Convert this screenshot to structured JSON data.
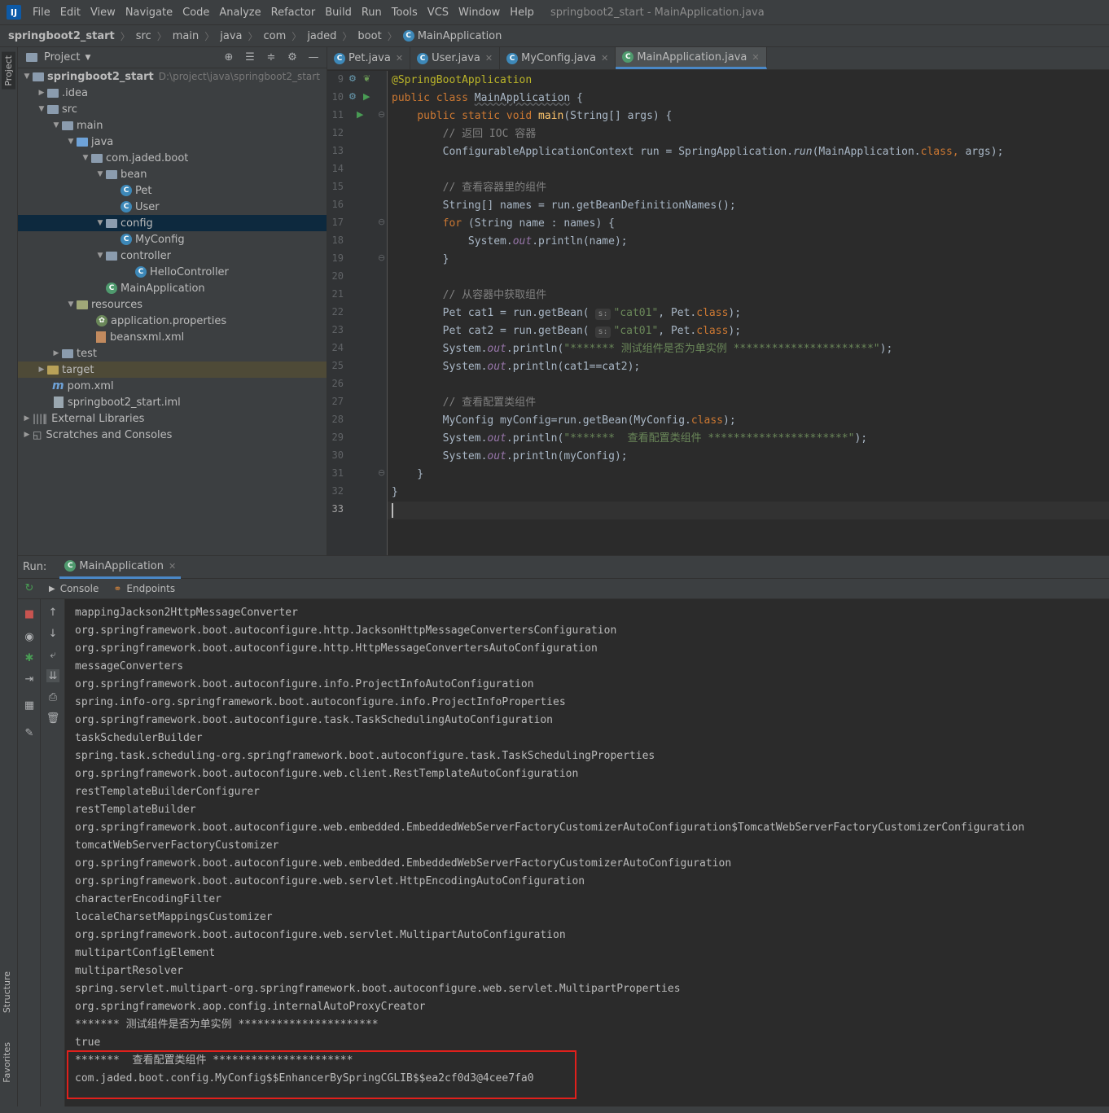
{
  "app": {
    "logo": "IJ",
    "window_title": "springboot2_start - MainApplication.java"
  },
  "menu": [
    "File",
    "Edit",
    "View",
    "Navigate",
    "Code",
    "Analyze",
    "Refactor",
    "Build",
    "Run",
    "Tools",
    "VCS",
    "Window",
    "Help"
  ],
  "breadcrumb": [
    "springboot2_start",
    "src",
    "main",
    "java",
    "com",
    "jaded",
    "boot",
    "MainApplication"
  ],
  "left_strip": {
    "project": "Project",
    "structure": "Structure",
    "favorites": "Favorites"
  },
  "project": {
    "title": "Project",
    "tree": [
      {
        "label": "springboot2_start",
        "path": "D:\\project\\java\\springboot2_start"
      },
      {
        "label": ".idea"
      },
      {
        "label": "src"
      },
      {
        "label": "main"
      },
      {
        "label": "java"
      },
      {
        "label": "com.jaded.boot"
      },
      {
        "label": "bean"
      },
      {
        "label": "Pet"
      },
      {
        "label": "User"
      },
      {
        "label": "config"
      },
      {
        "label": "MyConfig"
      },
      {
        "label": "controller"
      },
      {
        "label": "HelloController"
      },
      {
        "label": "MainApplication"
      },
      {
        "label": "resources"
      },
      {
        "label": "application.properties"
      },
      {
        "label": "beansxml.xml"
      },
      {
        "label": "test"
      },
      {
        "label": "target"
      },
      {
        "label": "pom.xml"
      },
      {
        "label": "springboot2_start.iml"
      },
      {
        "label": "External Libraries"
      },
      {
        "label": "Scratches and Consoles"
      }
    ]
  },
  "tabs": [
    {
      "label": "Pet.java"
    },
    {
      "label": "User.java"
    },
    {
      "label": "MyConfig.java"
    },
    {
      "label": "MainApplication.java"
    }
  ],
  "line_numbers": [
    "9",
    "10",
    "11",
    "12",
    "13",
    "14",
    "15",
    "16",
    "17",
    "18",
    "19",
    "20",
    "21",
    "22",
    "23",
    "24",
    "25",
    "26",
    "27",
    "28",
    "29",
    "30",
    "31",
    "32",
    "33"
  ],
  "code": {
    "l9a": "@SpringBootApplication",
    "l10a": "public class ",
    "l10b": "MainApplication",
    " l10c": " {",
    "l11a": "    public static void ",
    "l11b": "main",
    "l11c": "(String[] args) {",
    "l12": "        // 返回 IOC 容器",
    "l13a": "        ConfigurableApplicationContext run = SpringApplication.",
    "l13b": "run",
    "l13c": "(MainApplication.",
    "l13d": "class",
    ", l13e": ", args);",
    "l15": "        // 查看容器里的组件",
    "l16": "        String[] names = run.getBeanDefinitionNames();",
    "l17a": "        for ",
    "l17b": "(String name : names) {",
    "l18a": "            System.",
    "l18b": "out",
    "l18c": ".println(name);",
    "l19": "        }",
    "l21": "        // 从容器中获取组件",
    "l22a": "        Pet cat1 = run.getBean( ",
    "l22h": "s:",
    "l22b": "\"cat01\"",
    "l22c": ", Pet.",
    "l22d": "class",
    "l22e": ");",
    "l23a": "        Pet cat2 = run.getBean( ",
    "l23h": "s:",
    "l23b": "\"cat01\"",
    "l23c": ", Pet.",
    "l23d": "class",
    "l23e": ");",
    "l24a": "        System.",
    "l24b": "out",
    "l24c": ".println(",
    "l24d": "\"******* 测试组件是否为单实例 **********************\"",
    "l24e": ");",
    "l25a": "        System.",
    "l25b": "out",
    "l25c": ".println(cat1==cat2);",
    "l27": "        // 查看配置类组件",
    "l28a": "        MyConfig myConfig=run.getBean(MyConfig.",
    "l28b": "class",
    "l28c": ");",
    "l29a": "        System.",
    "l29b": "out",
    "l29c": ".println(",
    "l29d": "\"*******  查看配置类组件 **********************\"",
    "l29e": ");",
    "l30a": "        System.",
    "l30b": "out",
    "l30c": ".println(myConfig);",
    "l31": "    }",
    "l32": "}"
  },
  "run": {
    "label": "Run:",
    "config": "MainApplication",
    "console_tab": "Console",
    "endpoints_tab": "Endpoints"
  },
  "console": [
    "mappingJackson2HttpMessageConverter",
    "org.springframework.boot.autoconfigure.http.JacksonHttpMessageConvertersConfiguration",
    "org.springframework.boot.autoconfigure.http.HttpMessageConvertersAutoConfiguration",
    "messageConverters",
    "org.springframework.boot.autoconfigure.info.ProjectInfoAutoConfiguration",
    "spring.info-org.springframework.boot.autoconfigure.info.ProjectInfoProperties",
    "org.springframework.boot.autoconfigure.task.TaskSchedulingAutoConfiguration",
    "taskSchedulerBuilder",
    "spring.task.scheduling-org.springframework.boot.autoconfigure.task.TaskSchedulingProperties",
    "org.springframework.boot.autoconfigure.web.client.RestTemplateAutoConfiguration",
    "restTemplateBuilderConfigurer",
    "restTemplateBuilder",
    "org.springframework.boot.autoconfigure.web.embedded.EmbeddedWebServerFactoryCustomizerAutoConfiguration$TomcatWebServerFactoryCustomizerConfiguration",
    "tomcatWebServerFactoryCustomizer",
    "org.springframework.boot.autoconfigure.web.embedded.EmbeddedWebServerFactoryCustomizerAutoConfiguration",
    "org.springframework.boot.autoconfigure.web.servlet.HttpEncodingAutoConfiguration",
    "characterEncodingFilter",
    "localeCharsetMappingsCustomizer",
    "org.springframework.boot.autoconfigure.web.servlet.MultipartAutoConfiguration",
    "multipartConfigElement",
    "multipartResolver",
    "spring.servlet.multipart-org.springframework.boot.autoconfigure.web.servlet.MultipartProperties",
    "org.springframework.aop.config.internalAutoProxyCreator",
    "******* 测试组件是否为单实例 **********************",
    "true",
    "*******  查看配置类组件 **********************",
    "com.jaded.boot.config.MyConfig$$EnhancerBySpringCGLIB$$ea2cf0d3@4cee7fa0"
  ]
}
